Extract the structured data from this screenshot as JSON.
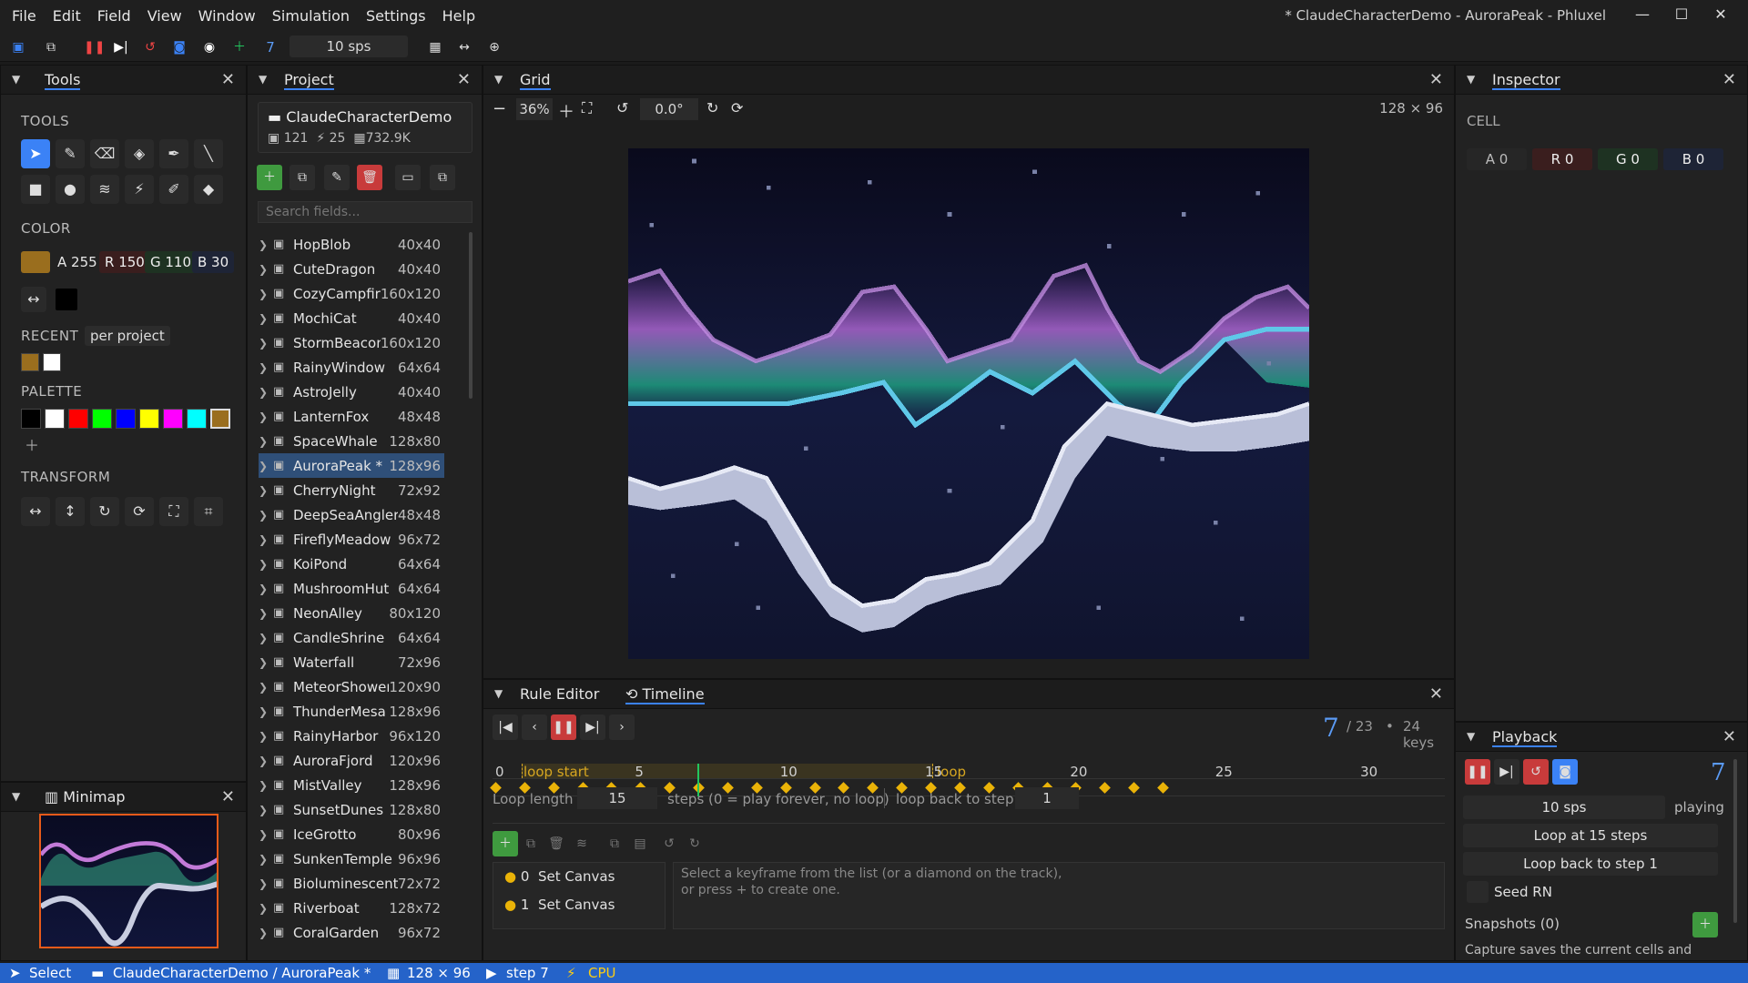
{
  "menu": [
    "File",
    "Edit",
    "Field",
    "View",
    "Window",
    "Simulation",
    "Settings",
    "Help"
  ],
  "window_title": "* ClaudeCharacterDemo - AuroraPeak - Phluxel",
  "toolbar": {
    "step": "7",
    "speed": "10 sps"
  },
  "tools_panel": {
    "title": "Tools",
    "tools_label": "TOOLS",
    "color_label": "COLOR",
    "a": "A 255",
    "r": "R 150",
    "g": "G 110",
    "b": "B 30",
    "recent_label": "RECENT",
    "per_project": "per project",
    "palette_label": "PALETTE",
    "transform_label": "TRANSFORM",
    "accent": "#9a6e1e"
  },
  "minimap": {
    "title": "Minimap"
  },
  "project": {
    "title": "Project",
    "name": "ClaudeCharacterDemo",
    "stat1": "121",
    "stat2": "25",
    "stat3": "732.9K",
    "search_placeholder": "Search fields...",
    "items": [
      [
        "HopBlob",
        "40x40"
      ],
      [
        "CuteDragon",
        "40x40"
      ],
      [
        "CozyCampfire",
        "160x120"
      ],
      [
        "MochiCat",
        "40x40"
      ],
      [
        "StormBeacon",
        "160x120"
      ],
      [
        "RainyWindow",
        "64x64"
      ],
      [
        "AstroJelly",
        "40x40"
      ],
      [
        "LanternFox",
        "48x48"
      ],
      [
        "SpaceWhale",
        "128x80"
      ],
      [
        "AuroraPeak  *",
        "128x96"
      ],
      [
        "CherryNight",
        "72x92"
      ],
      [
        "DeepSeaAngler",
        "48x48"
      ],
      [
        "FireflyMeadow",
        "96x72"
      ],
      [
        "KoiPond",
        "64x64"
      ],
      [
        "MushroomHut",
        "64x64"
      ],
      [
        "NeonAlley",
        "80x120"
      ],
      [
        "CandleShrine",
        "64x64"
      ],
      [
        "Waterfall",
        "72x96"
      ],
      [
        "MeteorShower",
        "120x90"
      ],
      [
        "ThunderMesa",
        "128x96"
      ],
      [
        "RainyHarbor",
        "96x120"
      ],
      [
        "AuroraFjord",
        "120x96"
      ],
      [
        "MistValley",
        "128x96"
      ],
      [
        "SunsetDunes",
        "128x80"
      ],
      [
        "IceGrotto",
        "80x96"
      ],
      [
        "SunkenTemple",
        "96x96"
      ],
      [
        "Bioluminescent",
        "72x72"
      ],
      [
        "Riverboat",
        "128x72"
      ],
      [
        "CoralGarden",
        "96x72"
      ]
    ]
  },
  "grid": {
    "title": "Grid",
    "zoom": "36%",
    "rotation": "0.0°",
    "size": "128 × 96"
  },
  "inspector": {
    "title": "Inspector",
    "cell_label": "CELL",
    "a": "A 0",
    "r": "R 0",
    "g": "G 0",
    "b": "B 0"
  },
  "timeline": {
    "tab1": "Rule Editor",
    "tab2": "Timeline",
    "step": "7",
    "total": "/ 23",
    "keys": "24 keys",
    "ticks": [
      "0",
      "5",
      "10",
      "15",
      "20",
      "25",
      "30"
    ],
    "loop_start": "loop start",
    "loop": "loop",
    "loop_length_label": "Loop length",
    "loop_length": "15",
    "steps_note": "steps  (0 = play forever, no loop)",
    "loop_back_label": "loop back to step",
    "loop_back": "1",
    "keyframes": [
      {
        "n": "0",
        "label": "Set Canvas"
      },
      {
        "n": "1",
        "label": "Set Canvas"
      }
    ],
    "hint1": "Select a keyframe from the list (or a diamond on the track),",
    "hint2": "or press + to create one.",
    "current": 7
  },
  "playback": {
    "title": "Playback",
    "step": "7",
    "speed": "10 sps",
    "state": "playing",
    "loop_at": "Loop at 15 steps",
    "loop_back": "Loop back to step 1",
    "seed": "Seed RN",
    "snapshots": "Snapshots (0)",
    "capture": "Capture saves the current cells and"
  },
  "status": {
    "tool": "Select",
    "path": "ClaudeCharacterDemo  /  AuroraPeak *",
    "size": "128 × 96",
    "step": "step 7",
    "cpu": "CPU"
  }
}
